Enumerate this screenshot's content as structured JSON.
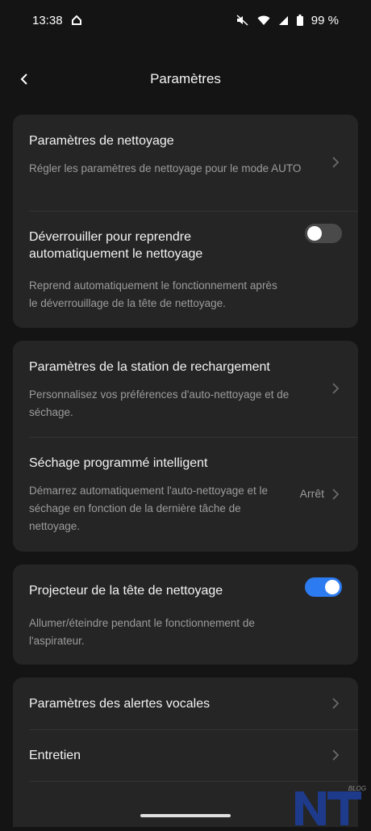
{
  "status_bar": {
    "time": "13:38",
    "battery": "99 %"
  },
  "header": {
    "title": "Paramètres"
  },
  "cards": [
    {
      "rows": [
        {
          "title": "Paramètres de nettoyage",
          "subtitle": "Régler les paramètres de nettoyage pour le mode AUTO"
        },
        {
          "title": "Déverrouiller pour reprendre automatiquement le nettoyage",
          "subtitle": "Reprend automatiquement le fonctionnement après le déverrouillage de la tête de nettoyage.",
          "toggle": false
        }
      ]
    },
    {
      "rows": [
        {
          "title": "Paramètres de la station de rechargement",
          "subtitle": "Personnalisez vos préférences d'auto-nettoyage et de séchage."
        },
        {
          "title": "Séchage programmé intelligent",
          "subtitle": "Démarrez automatiquement l'auto-nettoyage et le séchage en fonction de la dernière tâche de nettoyage.",
          "value": "Arrêt"
        }
      ]
    },
    {
      "rows": [
        {
          "title": "Projecteur de la tête de nettoyage",
          "subtitle": "Allumer/éteindre pendant le fonctionnement de l'aspirateur.",
          "toggle": true
        }
      ]
    },
    {
      "rows": [
        {
          "title": "Paramètres des alertes vocales"
        },
        {
          "title": "Entretien"
        }
      ]
    }
  ],
  "watermark": {
    "logo_text": "NT",
    "tag": "BLOG"
  },
  "colors": {
    "background": "#141414",
    "card": "#252525",
    "accent": "#2d7bf0"
  }
}
